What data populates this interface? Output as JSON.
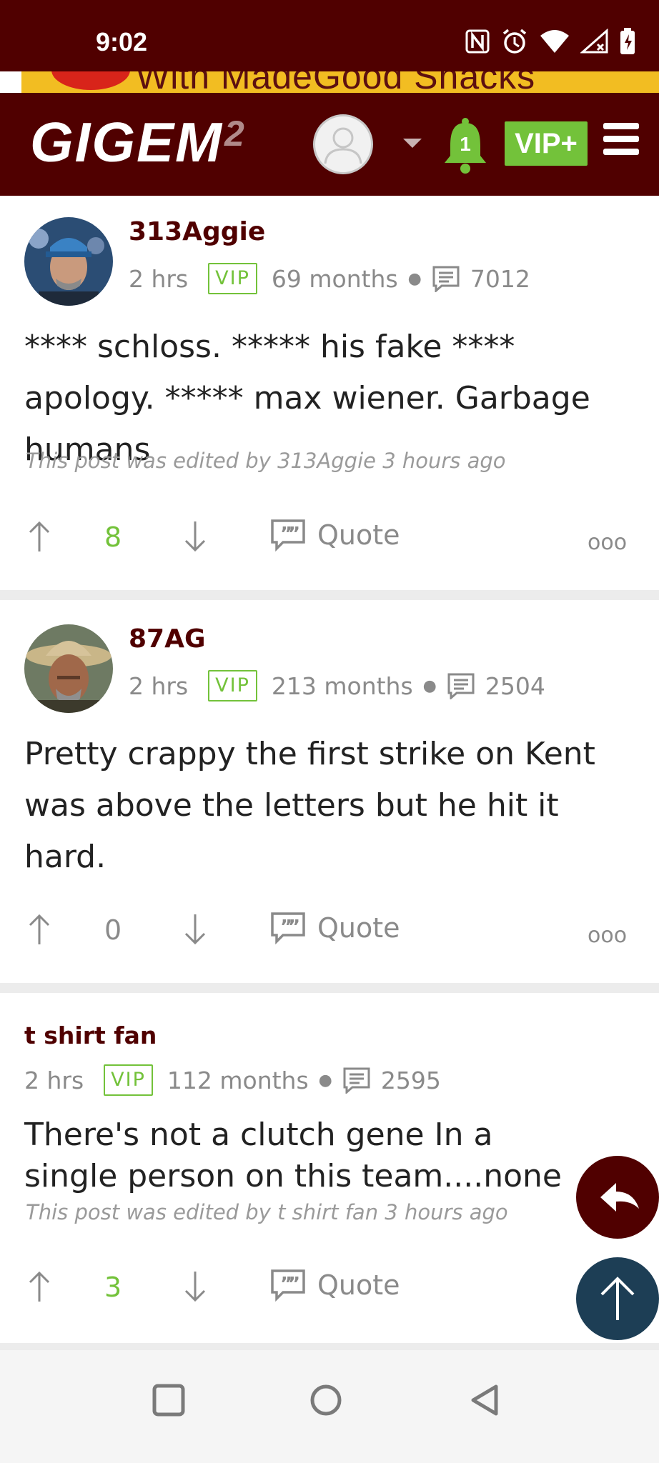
{
  "status_bar": {
    "time": "9:02"
  },
  "banner": {
    "text": "With MadeGood Snacks"
  },
  "header": {
    "logo_text": "GIGEM",
    "logo_sup": "2",
    "notification_count": "1",
    "vip_label": "VIP+"
  },
  "posts": [
    {
      "username": "313Aggie",
      "time": "2 hrs",
      "badge": "VIP",
      "tenure": "69 months",
      "post_count": "7012",
      "body": "**** schloss. ***** his fake **** apology. ***** max wiener. Garbage humans",
      "edited": "This post was edited by 313Aggie 3 hours ago",
      "votes": "8",
      "quote_label": "Quote",
      "more": "ooo"
    },
    {
      "username": "87AG",
      "time": "2 hrs",
      "badge": "VIP",
      "tenure": "213 months",
      "post_count": "2504",
      "body": "Pretty crappy the first strike on Kent was above the letters but he hit it hard.",
      "votes": "0",
      "quote_label": "Quote",
      "more": "ooo"
    },
    {
      "username": "t shirt fan",
      "time": "2 hrs",
      "badge": "VIP",
      "tenure": "112 months",
      "post_count": "2595",
      "body": "There's not a clutch gene In a single person on this team....none",
      "edited": "This post was edited by t shirt fan 3 hours ago",
      "votes": "3",
      "quote_label": "Quote"
    }
  ],
  "colors": {
    "brand": "#500000",
    "accent_green": "#73c23a",
    "scroll_top_button": "#1d3e55"
  }
}
